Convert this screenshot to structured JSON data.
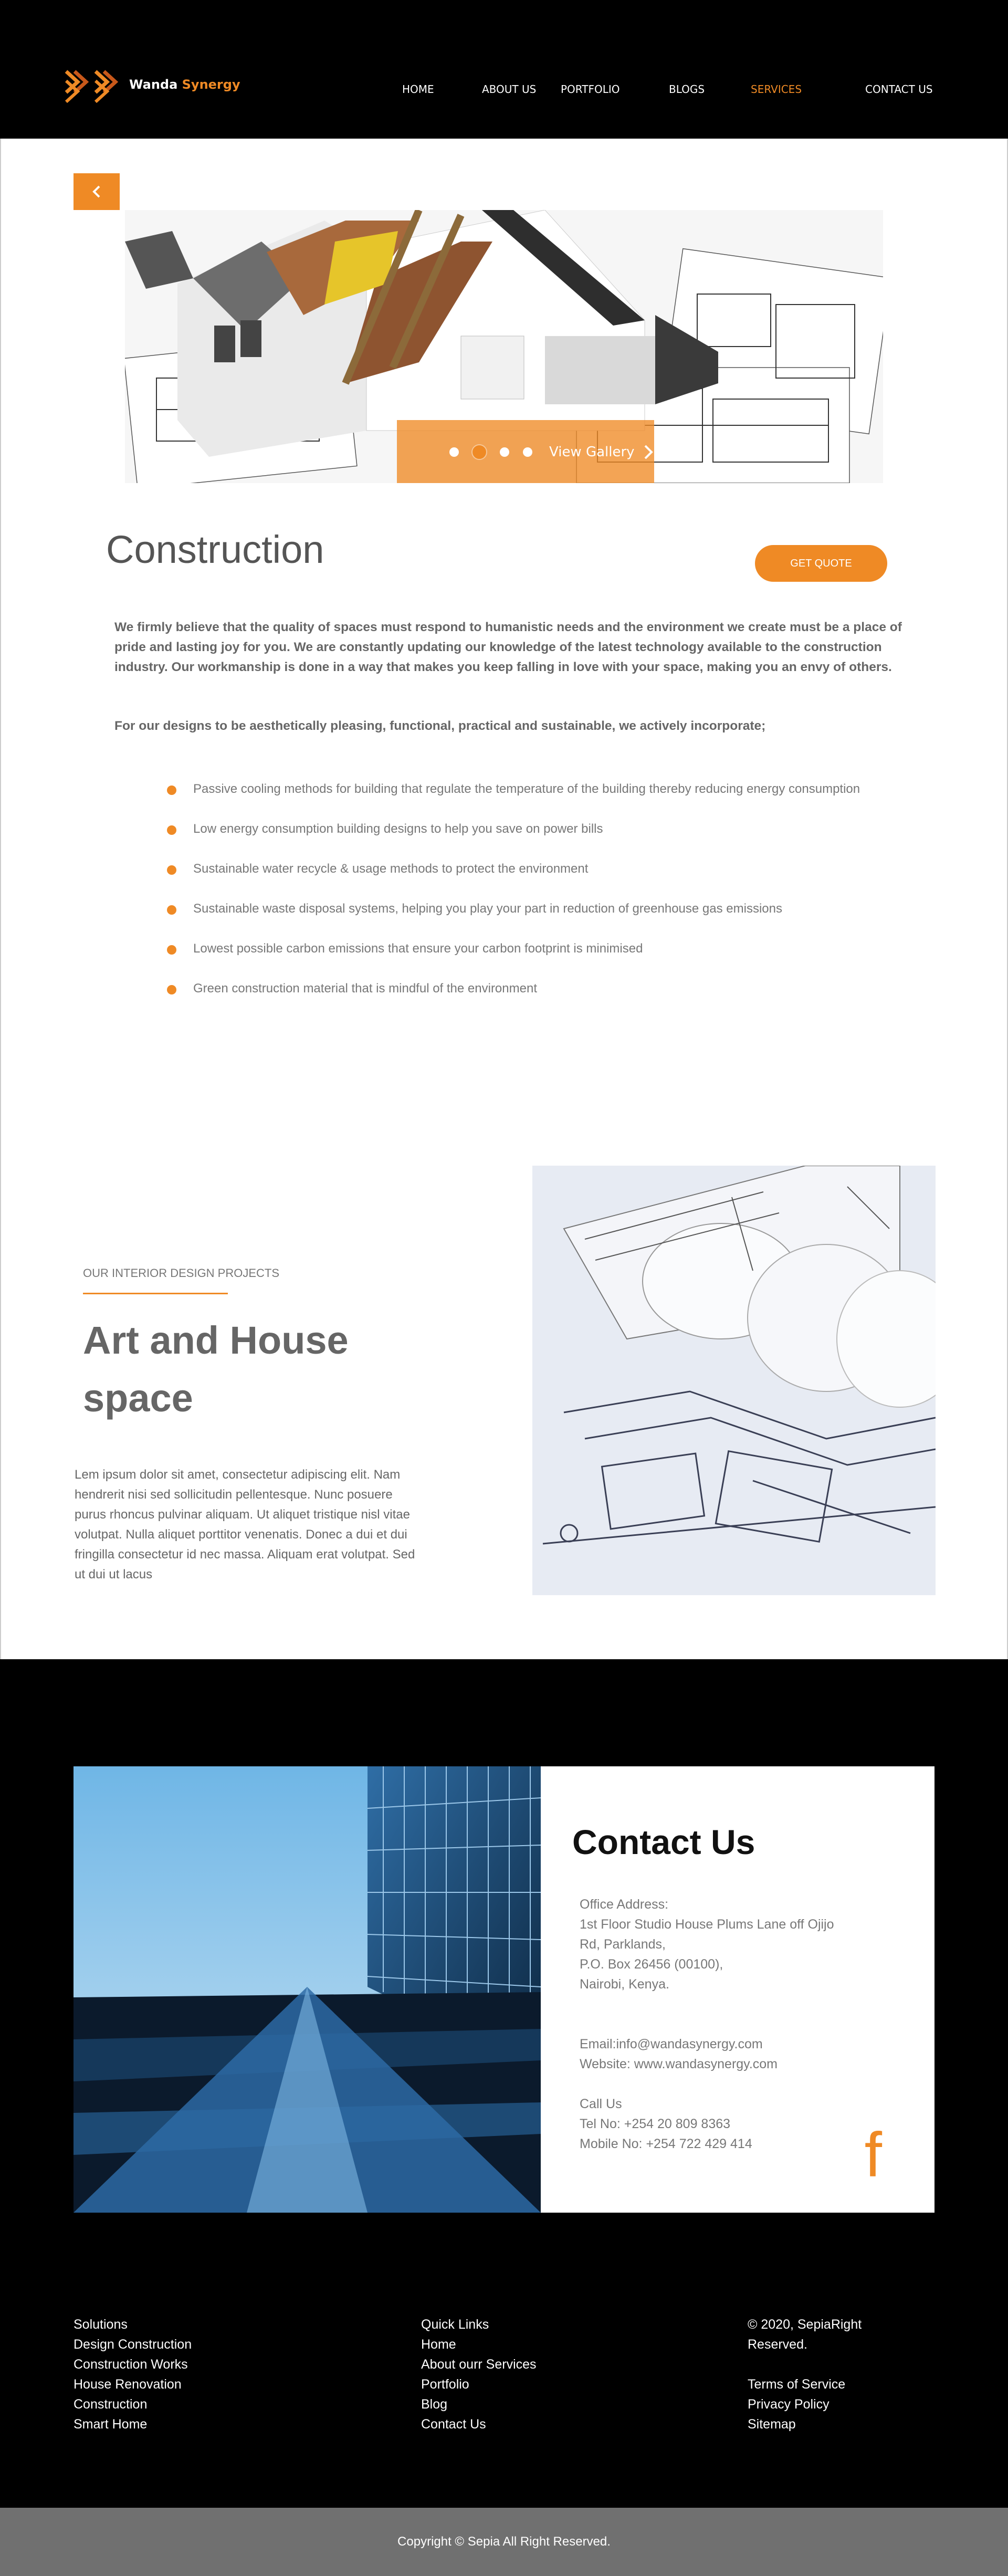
{
  "brand": {
    "name_part1": "Wanda ",
    "name_part2": "Synergy",
    "accent": "#ef8a25"
  },
  "nav": {
    "items": [
      {
        "label": "HOME"
      },
      {
        "label": "ABOUT US"
      },
      {
        "label": "PORTFOLIO"
      },
      {
        "label": "BLOGS"
      },
      {
        "label": "SERVICES",
        "active": true
      },
      {
        "label": "CONTACT US"
      }
    ]
  },
  "gallery": {
    "label": "View Gallery",
    "slide_count": 4,
    "active_slide": 2
  },
  "service": {
    "title": "Construction",
    "quote_button": "GET QUOTE",
    "intro": "We firmly believe that the quality of spaces must respond to humanistic needs and the environment we create must be a place of pride and lasting joy for you. We are constantly updating our knowledge of the latest technology available to the construction industry. Our workmanship is done in a way that makes you keep falling in love with your space, making you an envy of others.",
    "intro2": "For our designs to be aesthetically pleasing, functional, practical and sustainable, we actively incorporate;",
    "bullets": [
      "Passive cooling methods for building that regulate the temperature of the building thereby reducing energy consumption",
      "Low energy consumption building designs to help you save on power bills",
      "Sustainable water recycle & usage methods to protect the environment",
      "Sustainable waste disposal systems, helping you play your part in reduction of greenhouse gas emissions",
      "Lowest possible carbon emissions that ensure your carbon footprint is minimised",
      "Green construction material that is mindful of the environment"
    ]
  },
  "interior": {
    "kicker": "OUR INTERIOR DESIGN PROJECTS",
    "title": "Art and House space",
    "body": "Lem ipsum dolor sit amet, consectetur adipiscing elit. Nam hendrerit nisi sed sollicitudin pellentesque. Nunc posuere purus rhoncus pulvinar aliquam. Ut aliquet tristique nisl vitae volutpat. Nulla aliquet porttitor venenatis. Donec a dui et dui fringilla consectetur id nec massa. Aliquam erat volutpat. Sed ut dui ut lacus"
  },
  "contact": {
    "title": "Contact Us",
    "address_label": "Office Address:",
    "address_lines": [
      "1st Floor Studio House Plums Lane off Ojijo",
      "Rd, Parklands,",
      "P.O. Box 26456 (00100),",
      "Nairobi, Kenya."
    ],
    "email": "Email:info@wandasynergy.com",
    "website": "Website: www.wandasynergy.com",
    "call_label": "Call Us",
    "tel": "Tel No: +254 20 809 8363",
    "mobile": "Mobile No: +254 722 429 414",
    "facebook_glyph": "f"
  },
  "footer": {
    "solutions": [
      "Solutions",
      "Design Construction",
      "Construction Works",
      "House Renovation",
      "Construction",
      "Smart Home"
    ],
    "quick_links": [
      "Quick Links",
      "Home",
      "About ourr Services",
      "Portfolio",
      "Blog",
      "Contact Us"
    ],
    "legal_top": [
      "© 2020, SepiaRight",
      "Reserved."
    ],
    "legal_links": [
      "Terms of Service",
      "Privacy Policy",
      "Sitemap"
    ],
    "copyright": "Copyright © Sepia All Right Reserved."
  }
}
